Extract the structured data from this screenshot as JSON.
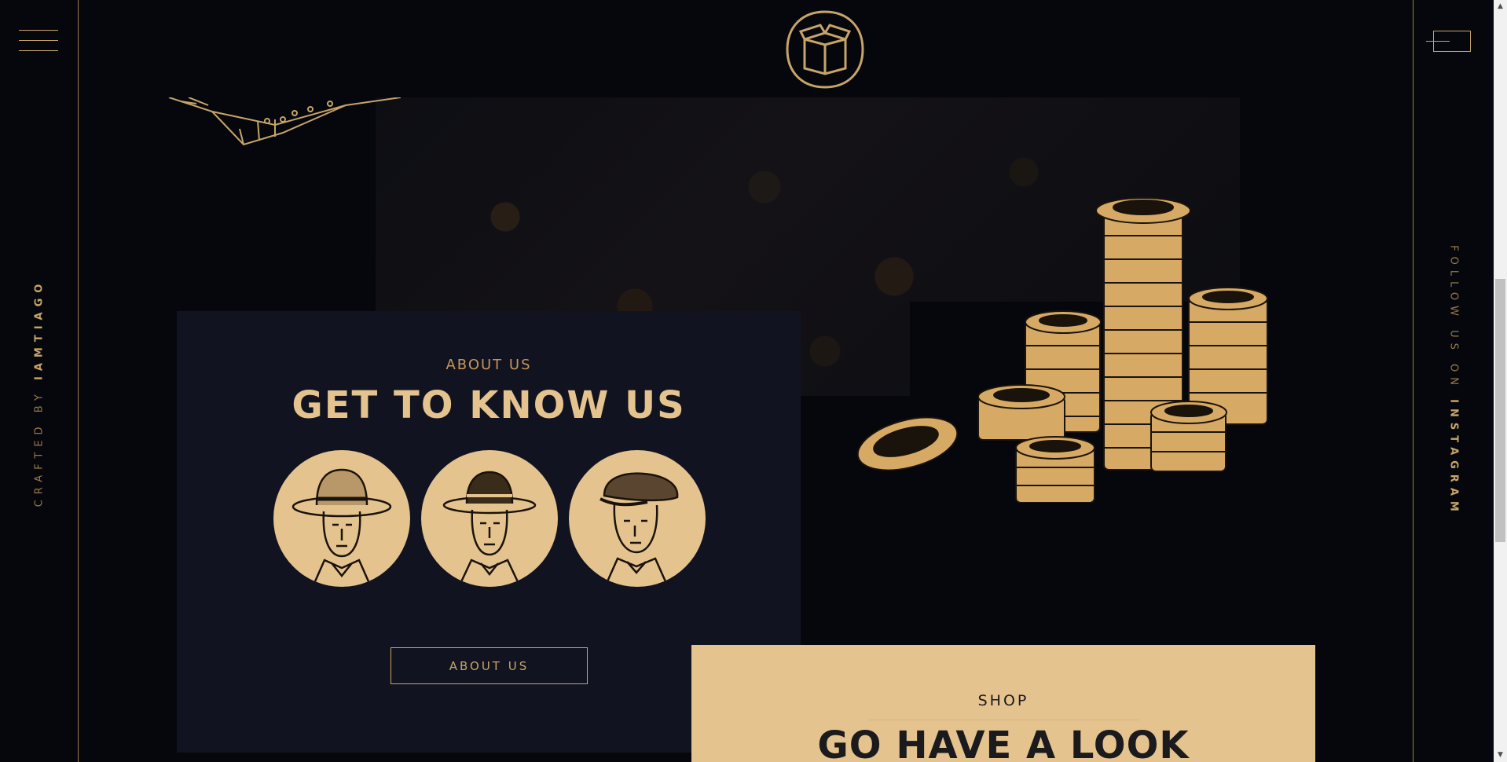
{
  "rails": {
    "left_text_prefix": "CRAFTED BY",
    "left_text_brand": "IAMTIAGO",
    "right_text_prefix": "FOLLOW US ON",
    "right_text_brand": "INSTAGRAM"
  },
  "header": {
    "logo_icon": "open-box-icon",
    "menu_icon": "hamburger-icon",
    "cart_icon": "cart-box-icon"
  },
  "about": {
    "kicker": "ABOUT US",
    "title": "GET TO KNOW US",
    "button_label": "ABOUT US",
    "portraits": [
      "man-fedora-portrait",
      "man-homburg-portrait",
      "man-flat-cap-portrait"
    ]
  },
  "shop": {
    "kicker": "SHOP",
    "title": "GO HAVE A LOOK"
  },
  "colors": {
    "background": "#05070d",
    "card": "#111420",
    "gold": "#e4c38f",
    "gold_dark": "#c8a468"
  }
}
